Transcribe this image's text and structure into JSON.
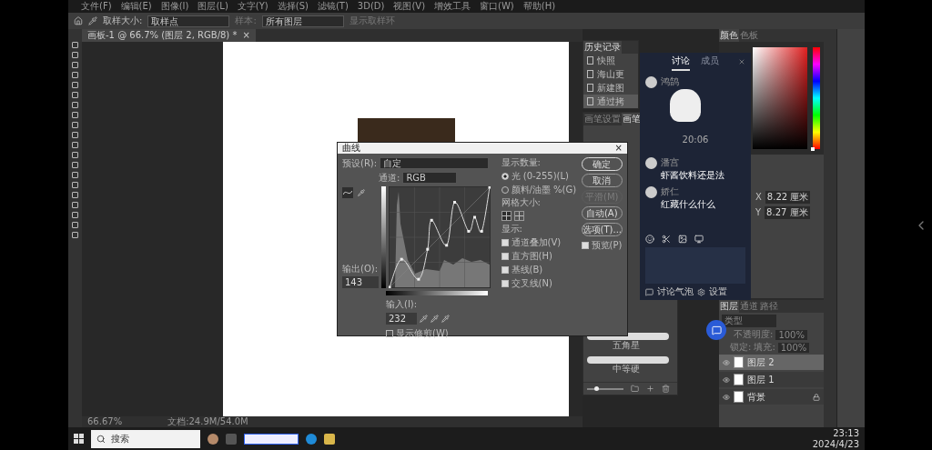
{
  "menu_bar": {
    "items": [
      "文件(F)",
      "编辑(E)",
      "图像(I)",
      "图层(L)",
      "文字(Y)",
      "选择(S)",
      "滤镜(T)",
      "3D(D)",
      "视图(V)",
      "增效工具",
      "窗口(W)",
      "帮助(H)"
    ]
  },
  "options_bar": {
    "sample_size_label": "取样大小:",
    "sample_size": "取样点",
    "sample_label": "样本:",
    "sample": "所有图层",
    "show_ring": "显示取样环"
  },
  "document_tab": {
    "title": "画板-1 @ 66.7% (图层 2, RGB/8) *",
    "close": "×"
  },
  "status_bar": {
    "zoom": "66.67%",
    "document": "文档:24.9M/54.0M"
  },
  "history_panel": {
    "title": "历史记录",
    "items": [
      {
        "label": "快照",
        "selected": false
      },
      {
        "label": "海山更",
        "selected": false
      },
      {
        "label": "新建图",
        "selected": false
      },
      {
        "label": "通过拷",
        "selected": true
      }
    ]
  },
  "brush_panel": {
    "tabs": [
      {
        "label": "画笔设置",
        "selected": false
      },
      {
        "label": "画笔",
        "selected": true
      }
    ],
    "brushes": [
      "五角星",
      "中等硬"
    ],
    "size_slider": {
      "level": 0.25
    }
  },
  "color_panel": {
    "tabs": [
      {
        "label": "颜色",
        "selected": true
      },
      {
        "label": "色板",
        "selected": false
      }
    ],
    "hue_slider": {
      "level": 0
    }
  },
  "properties_panel": {
    "fields": [
      {
        "label": "X",
        "value": "8.22 厘米"
      },
      {
        "label": "Y",
        "value": "8.27 厘米"
      }
    ]
  },
  "layers_panel": {
    "tabs": [
      {
        "label": "图层",
        "selected": true
      },
      {
        "label": "通道",
        "selected": false
      },
      {
        "label": "路径",
        "selected": false
      }
    ],
    "search_placeholder": "类型",
    "opacity_label": "不透明度:",
    "opacity": "100%",
    "lock_label": "锁定:",
    "fill_label": "填充:",
    "fill": "100%",
    "layers": [
      {
        "name": "图层 2",
        "selected": true,
        "locked": false
      },
      {
        "name": "图层 1",
        "selected": false,
        "locked": false
      },
      {
        "name": "背景",
        "selected": false,
        "locked": true
      }
    ]
  },
  "curves": {
    "title": "曲线",
    "close": "×",
    "preset_label": "预设(R):",
    "preset": "自定",
    "channel_label": "通道:",
    "channel": "RGB",
    "output_label": "输出(O):",
    "output": "143",
    "input_label": "输入(I):",
    "input": "232",
    "show_clipping": {
      "label": "显示修剪(W)",
      "checked": false
    },
    "amount_label": "显示数量:",
    "amount_options": [
      {
        "label": "光 (0-255)(L)",
        "selected": true
      },
      {
        "label": "颜料/油墨 %(G)",
        "selected": false
      }
    ],
    "grid_label": "网格大小:",
    "grid_sizes": [
      {
        "selected": true
      },
      {
        "selected": false
      }
    ],
    "show_label": "显示:",
    "show_options": [
      {
        "label": "通道叠加(V)",
        "checked": true
      },
      {
        "label": "直方图(H)",
        "checked": true
      },
      {
        "label": "基线(B)",
        "checked": true
      },
      {
        "label": "交叉线(N)",
        "checked": true
      }
    ],
    "buttons": [
      {
        "label": "确定",
        "disabled": false
      },
      {
        "label": "取消",
        "disabled": false
      },
      {
        "label": "平滑(M)",
        "disabled": true
      },
      {
        "label": "自动(A)",
        "disabled": false
      },
      {
        "label": "选项(T)...",
        "disabled": false
      }
    ],
    "preview": {
      "label": "预览(P)",
      "checked": true
    }
  },
  "chat": {
    "tabs": [
      {
        "label": "讨论",
        "selected": true
      },
      {
        "label": "成员",
        "selected": false
      }
    ],
    "messages": [
      {
        "kind": "sticker",
        "name": "鸿鹄"
      },
      {
        "kind": "time",
        "text": "20:06"
      },
      {
        "kind": "text",
        "name": "潘宫",
        "text": "虾酱饮料还是法"
      },
      {
        "kind": "text",
        "name": "娇仁",
        "text": "红藏什么什么"
      }
    ],
    "footer": {
      "bubble": "讨论气泡",
      "settings": "设置"
    }
  },
  "taskbar": {
    "search_placeholder": "搜索",
    "time": "23:13",
    "date": "2024/4/23"
  }
}
